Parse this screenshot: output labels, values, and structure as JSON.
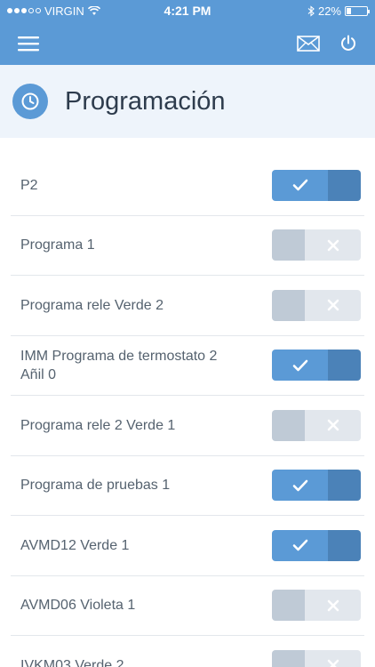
{
  "status_bar": {
    "carrier": "VIRGIN",
    "time": "4:21 PM",
    "battery": "22%",
    "battery_level": 0.22
  },
  "header": {
    "title": "Programación"
  },
  "programs": [
    {
      "label": "P2",
      "enabled": true
    },
    {
      "label": "Programa 1",
      "enabled": false
    },
    {
      "label": "Programa rele Verde 2",
      "enabled": false
    },
    {
      "label": "IMM Programa de termostato 2\nAñil 0",
      "enabled": true
    },
    {
      "label": "Programa rele 2 Verde 1",
      "enabled": false
    },
    {
      "label": "Programa de pruebas 1",
      "enabled": true
    },
    {
      "label": "AVMD12 Verde 1",
      "enabled": true
    },
    {
      "label": "AVMD06 Violeta 1",
      "enabled": false
    },
    {
      "label": "IVKM03 Verde 2",
      "enabled": false
    }
  ],
  "icons": {
    "menu": "hamburger-menu-icon",
    "mail": "mail-icon",
    "power": "power-icon",
    "header": "clock-icon",
    "on": "check-icon",
    "off": "x-icon"
  },
  "colors": {
    "primary": "#5b9ad6",
    "primary_dark": "#4b82b8",
    "off_light": "#e2e7ed",
    "off_dark": "#bfcad6"
  }
}
